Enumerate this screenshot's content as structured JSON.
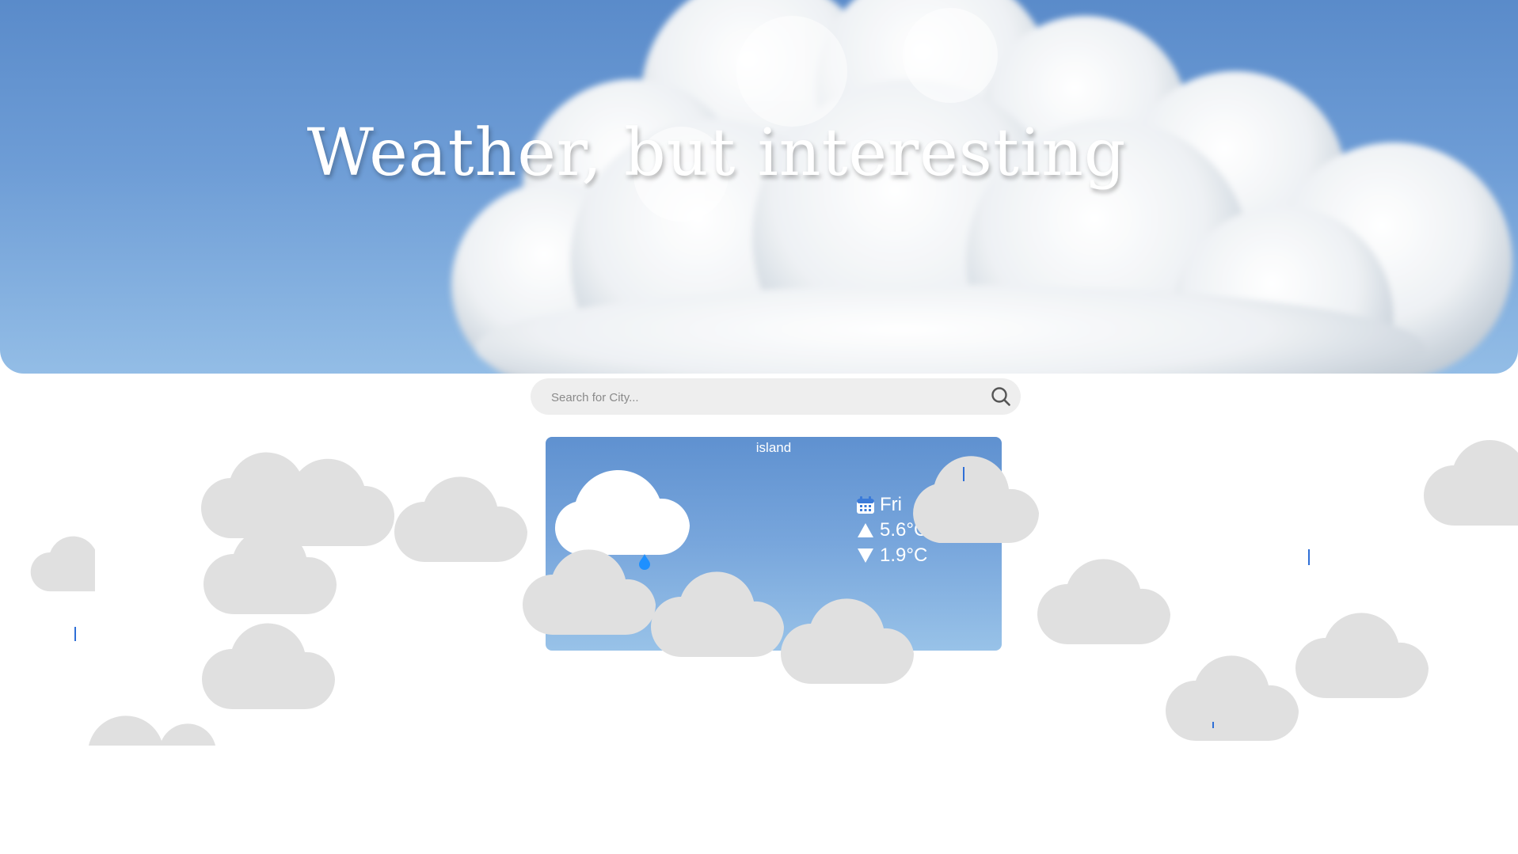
{
  "hero": {
    "title": "Weather, but interesting"
  },
  "search": {
    "placeholder": "Search for City...",
    "value": "",
    "icon": "search-icon"
  },
  "card": {
    "city": "island",
    "condition_icon": "cloud-icon",
    "precip_icon": "raindrop-icon",
    "day_icon": "calendar-icon",
    "day": "Fri",
    "high_icon": "triangle-up-icon",
    "high": "5.6°C",
    "low_icon": "triangle-down-icon",
    "low": "1.9°C"
  },
  "colors": {
    "sky_top": "#5a8bca",
    "sky_bottom": "#93bde6",
    "cloud_gray": "#e0e0e0",
    "rain_blue": "#2f6fd6"
  }
}
